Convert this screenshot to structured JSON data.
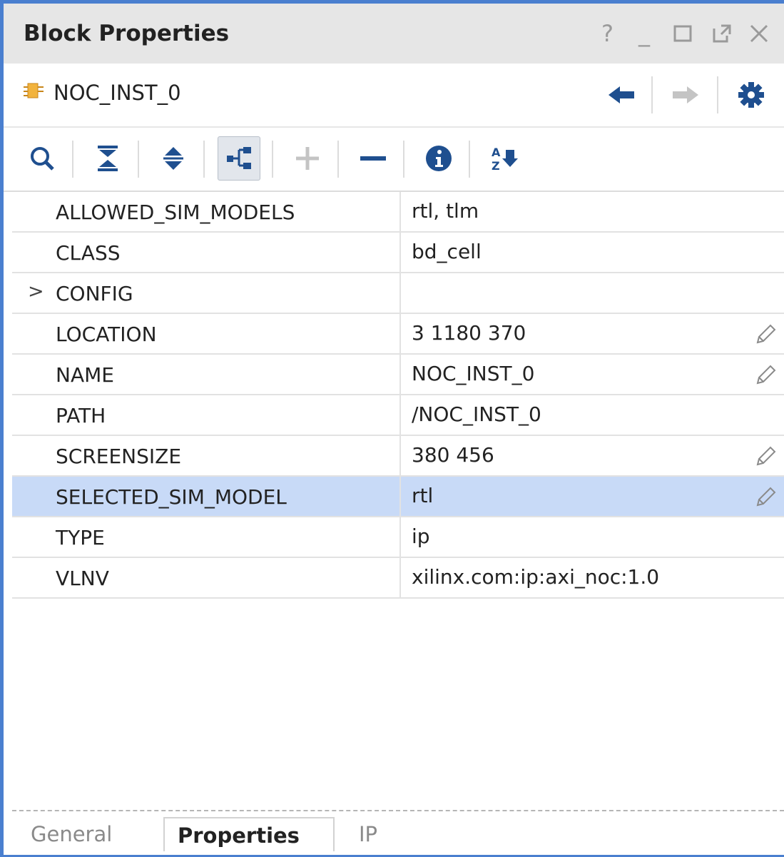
{
  "window": {
    "title": "Block Properties",
    "controls": {
      "help": "?",
      "minimize": "_"
    }
  },
  "header": {
    "object_name": "NOC_INST_0"
  },
  "toolbar": {
    "buttons": [
      "search-icon",
      "collapse-all-icon",
      "expand-all-icon",
      "hierarchy-icon",
      "add-icon",
      "remove-icon",
      "info-icon",
      "sort-icon"
    ],
    "sort_glyph_top": "A",
    "sort_glyph_bottom": "Z"
  },
  "properties": [
    {
      "name": "ALLOWED_SIM_MODELS",
      "value": "rtl, tlm",
      "editable": false
    },
    {
      "name": "CLASS",
      "value": "bd_cell",
      "editable": false
    },
    {
      "name": "CONFIG",
      "value": "",
      "editable": false,
      "expander": ">"
    },
    {
      "name": "LOCATION",
      "value": "3 1180 370",
      "editable": true
    },
    {
      "name": "NAME",
      "value": "NOC_INST_0",
      "editable": true
    },
    {
      "name": "PATH",
      "value": "/NOC_INST_0",
      "editable": false
    },
    {
      "name": "SCREENSIZE",
      "value": "380 456",
      "editable": true
    },
    {
      "name": "SELECTED_SIM_MODEL",
      "value": "rtl",
      "editable": true,
      "selected": true
    },
    {
      "name": "TYPE",
      "value": "ip",
      "editable": false
    },
    {
      "name": "VLNV",
      "value": "xilinx.com:ip:axi_noc:1.0",
      "editable": false
    }
  ],
  "tabs": [
    {
      "label": "General",
      "active": false
    },
    {
      "label": "Properties",
      "active": true
    },
    {
      "label": "IP",
      "active": false
    }
  ],
  "colors": {
    "accent_border": "#4a7fcf",
    "selected_row": "#c8daf7",
    "icon_blue": "#1f4f8f"
  }
}
